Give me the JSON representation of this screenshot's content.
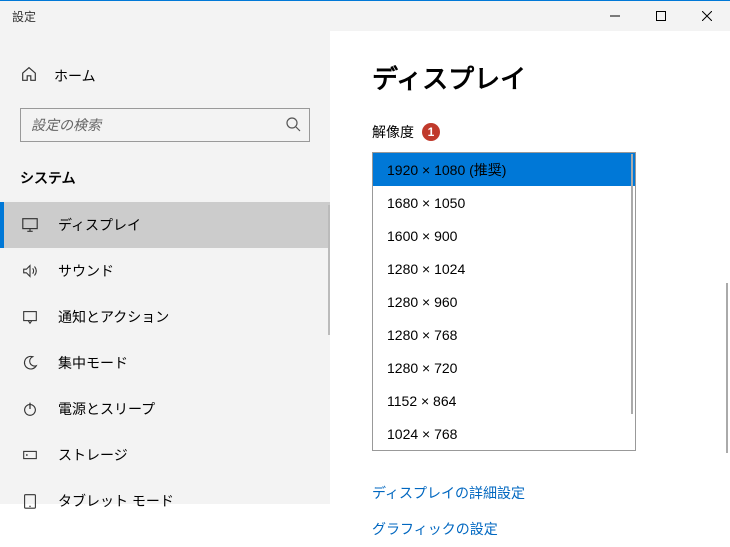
{
  "window": {
    "title": "設定"
  },
  "sidebar": {
    "home": "ホーム",
    "search_placeholder": "設定の検索",
    "section": "システム",
    "items": [
      {
        "label": "ディスプレイ"
      },
      {
        "label": "サウンド"
      },
      {
        "label": "通知とアクション"
      },
      {
        "label": "集中モード"
      },
      {
        "label": "電源とスリープ"
      },
      {
        "label": "ストレージ"
      },
      {
        "label": "タブレット モード"
      }
    ]
  },
  "main": {
    "heading": "ディスプレイ",
    "resolution_label": "解像度",
    "badge": "1",
    "options": [
      "1920 × 1080 (推奨)",
      "1680 × 1050",
      "1600 × 900",
      "1280 × 1024",
      "1280 × 960",
      "1280 × 768",
      "1280 × 720",
      "1152 × 864",
      "1024 × 768"
    ],
    "selected_index": 0,
    "links": [
      "ディスプレイの詳細設定",
      "グラフィックの設定"
    ]
  }
}
